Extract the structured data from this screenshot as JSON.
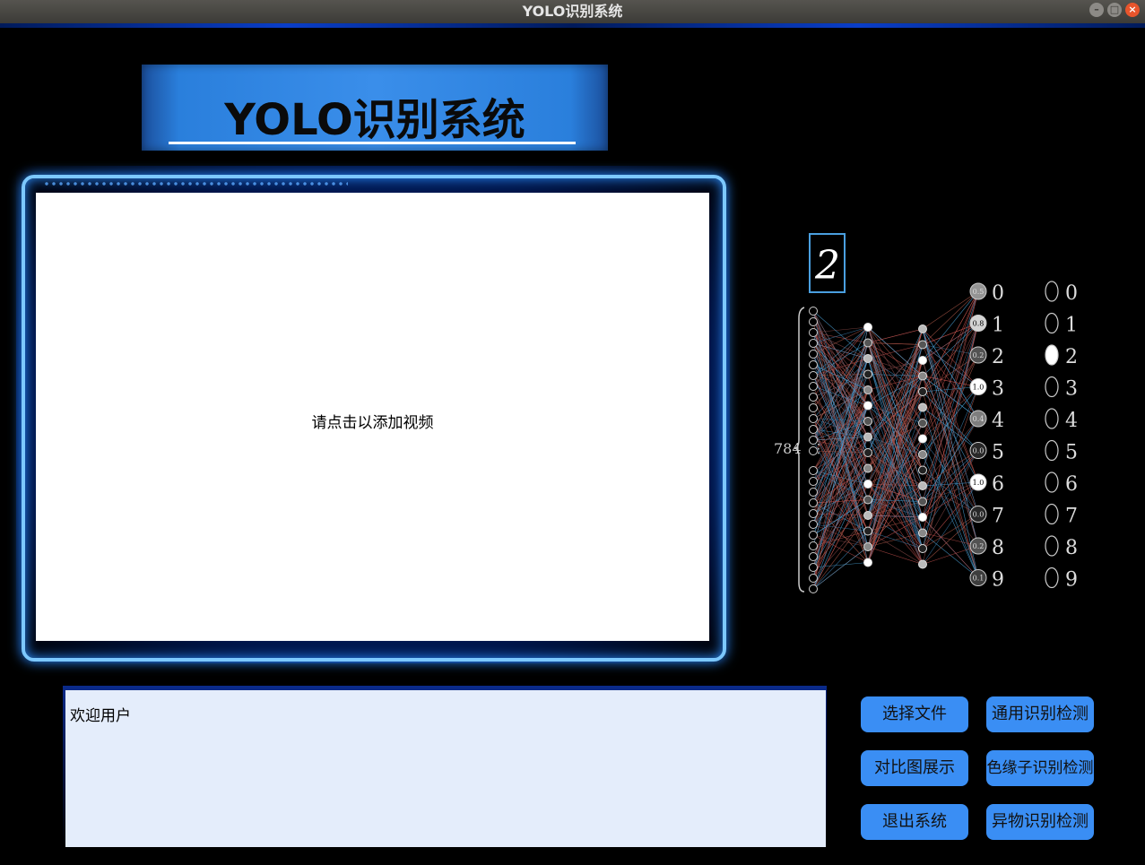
{
  "window": {
    "title": "YOLO识别系统"
  },
  "banner": {
    "title": "YOLO识别系统"
  },
  "video": {
    "placeholder": "请点击以添加视频"
  },
  "log": {
    "text": "欢迎用户"
  },
  "buttons": {
    "select_file": "选择文件",
    "general_detect": "通用识别检测",
    "compare_show": "对比图展示",
    "color_detect": "色缘子识别检测",
    "exit": "退出系统",
    "foreign_detect": "异物识别检测"
  },
  "network_illustration": {
    "digit_image": "2",
    "input_count": "784",
    "output_values": [
      "0.5",
      "0.8",
      "0.2",
      "1.0",
      "0.4",
      "0.0",
      "1.0",
      "0.0",
      "0.2",
      "0.1"
    ],
    "output_labels": [
      "0",
      "1",
      "2",
      "3",
      "4",
      "5",
      "6",
      "7",
      "8",
      "9"
    ],
    "result_labels": [
      "0",
      "1",
      "2",
      "3",
      "4",
      "5",
      "6",
      "7",
      "8",
      "9"
    ],
    "selected_result": "2"
  },
  "colors": {
    "accent": "#3a8ef4",
    "frame_glow": "#7cc8ff",
    "log_bg": "#e4edfb"
  }
}
